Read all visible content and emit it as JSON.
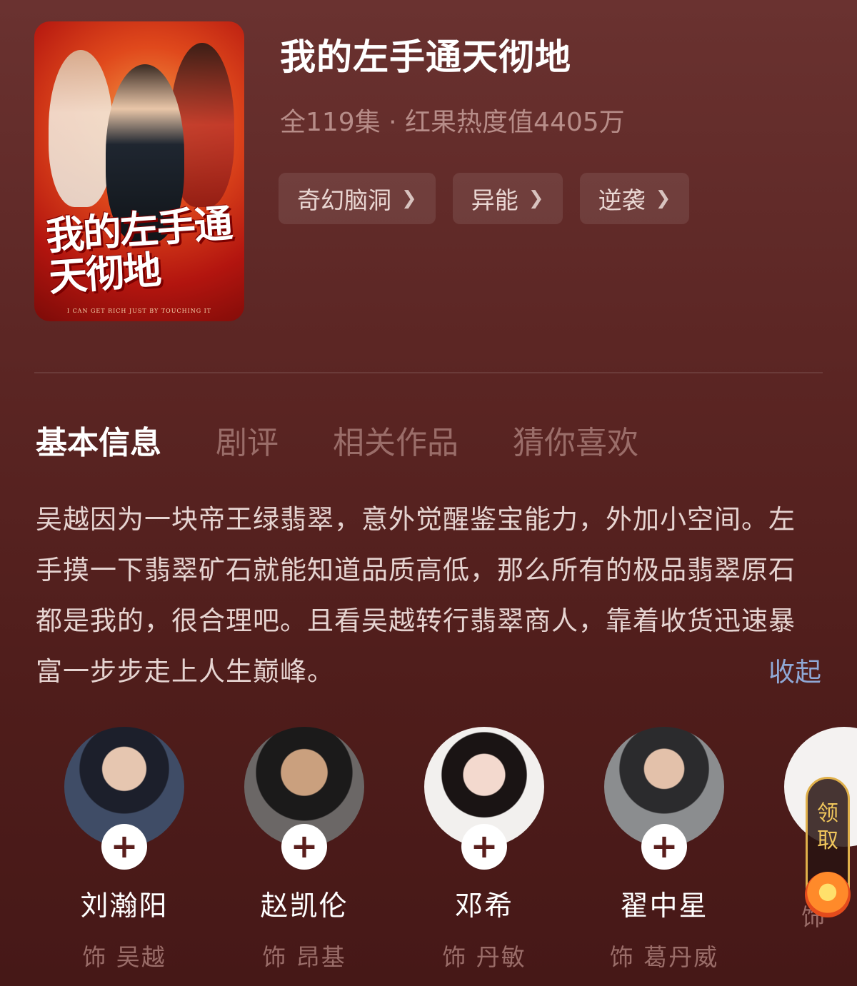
{
  "drama": {
    "title": "我的左手通天彻地",
    "meta": "全119集 · 红果热度值4405万",
    "poster_title": "我的左手通天彻地",
    "poster_subtitle": "I CAN GET RICH JUST BY TOUCHING IT"
  },
  "tags": [
    {
      "label": "奇幻脑洞"
    },
    {
      "label": "异能"
    },
    {
      "label": "逆袭"
    }
  ],
  "tabs": [
    {
      "label": "基本信息",
      "active": true
    },
    {
      "label": "剧评",
      "active": false
    },
    {
      "label": "相关作品",
      "active": false
    },
    {
      "label": "猜你喜欢",
      "active": false
    }
  ],
  "description": "吴越因为一块帝王绿翡翠，意外觉醒鉴宝能力，外加小空间。左手摸一下翡翠矿石就能知道品质高低，那么所有的极品翡翠原石都是我的，很合理吧。且看吴越转行翡翠商人，靠着收货迅速暴富一步步走上人生巅峰。",
  "collapse_label": "收起",
  "cast": [
    {
      "name": "刘瀚阳",
      "role": "饰 吴越"
    },
    {
      "name": "赵凯伦",
      "role": "饰 昂基"
    },
    {
      "name": "邓希",
      "role": "饰 丹敏"
    },
    {
      "name": "翟中星",
      "role": "饰 葛丹威"
    },
    {
      "name": "",
      "role": "饰"
    }
  ],
  "follow_icon": "plus-icon",
  "chevron_icon": "chevron-right-icon",
  "reward_badge": {
    "label_1": "领",
    "label_2": "取"
  },
  "colors": {
    "background": "#5c2624",
    "tab_active": "#ffffff",
    "tab_inactive": "#9a6d69",
    "link": "#8fa8d6",
    "badge_accent": "#f1c75c"
  }
}
